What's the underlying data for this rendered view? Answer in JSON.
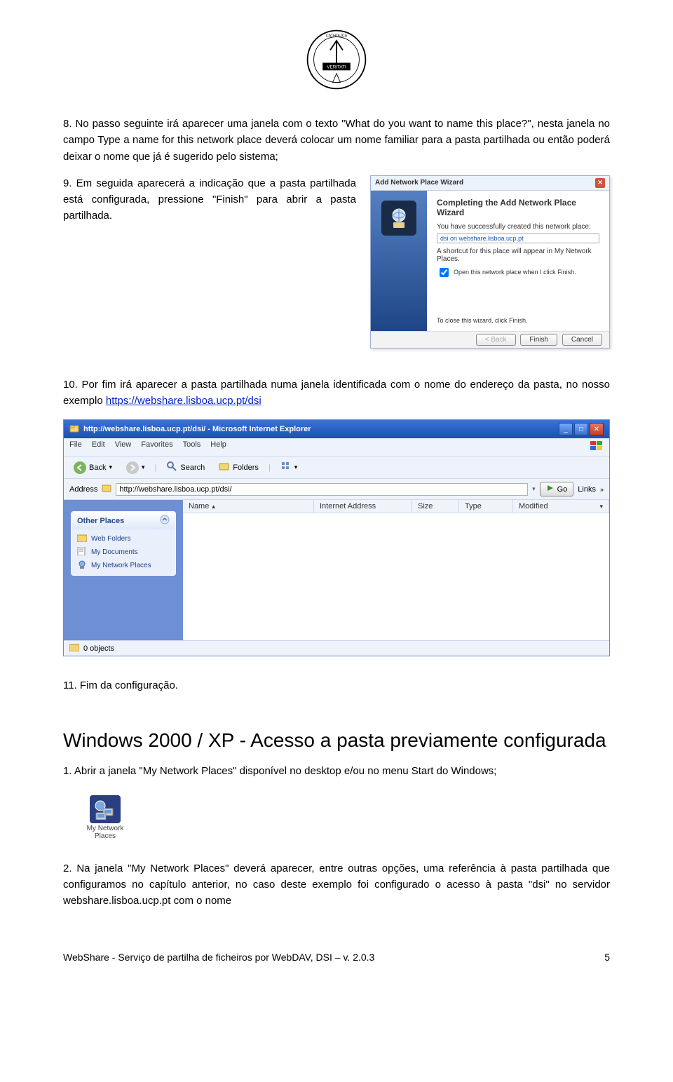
{
  "steps": {
    "s8": "8. No passo seguinte irá aparecer uma janela com o texto \"What do you want to name this place?\", nesta janela no campo Type a name for this network place deverá colocar um nome familiar para a pasta partilhada ou então poderá deixar o nome que já é sugerido pelo sistema;",
    "s9": "9. Em seguida aparecerá a indicação que a pasta partilhada está configurada, pressione \"Finish\" para abrir a pasta partilhada.",
    "s10_pre": "10. Por fim irá aparecer a pasta partilhada numa janela identificada com o nome do endereço da pasta, no nosso exemplo ",
    "s10_link": "https://webshare.lisboa.ucp.pt/dsi",
    "s11": "11. Fim da configuração."
  },
  "wizard": {
    "titlebar": "Add Network Place Wizard",
    "heading": "Completing the Add Network Place Wizard",
    "sub1": "You have successfully created this network place:",
    "url": "dsi on webshare.lisboa.ucp.pt",
    "sub2": "A shortcut for this place will appear in My Network Places.",
    "checkbox": "Open this network place when I click Finish.",
    "close_hint": "To close this wizard, click Finish.",
    "btn_back": "< Back",
    "btn_finish": "Finish",
    "btn_cancel": "Cancel"
  },
  "ie": {
    "title": "http://webshare.lisboa.ucp.pt/dsi/ - Microsoft Internet Explorer",
    "menu": [
      "File",
      "Edit",
      "View",
      "Favorites",
      "Tools",
      "Help"
    ],
    "tb": {
      "back": "Back",
      "search": "Search",
      "folders": "Folders"
    },
    "addr_label": "Address",
    "addr_value": "http://webshare.lisboa.ucp.pt/dsi/",
    "go": "Go",
    "links": "Links",
    "cols": {
      "name": "Name",
      "addr": "Internet Address",
      "size": "Size",
      "type": "Type",
      "mod": "Modified"
    },
    "panel_title": "Other Places",
    "panel_items": [
      "Web Folders",
      "My Documents",
      "My Network Places"
    ],
    "status": "0 objects"
  },
  "section_heading": "Windows 2000 / XP - Acesso a pasta previamente configurada",
  "step1b": "1. Abrir a janela \"My Network Places\" disponível no desktop e/ou no menu Start do Windows;",
  "desktop_icon_label": "My Network Places",
  "step2b": "2. Na janela \"My Network Places\" deverá aparecer, entre outras opções, uma referência à pasta partilhada que configuramos no capítulo anterior, no caso deste exemplo foi configurado o acesso à pasta \"dsi\" no servidor webshare.lisboa.ucp.pt com o nome",
  "footer_left": "WebShare - Serviço de partilha de ficheiros por WebDAV, DSI – v. 2.0.3",
  "footer_right": "5"
}
